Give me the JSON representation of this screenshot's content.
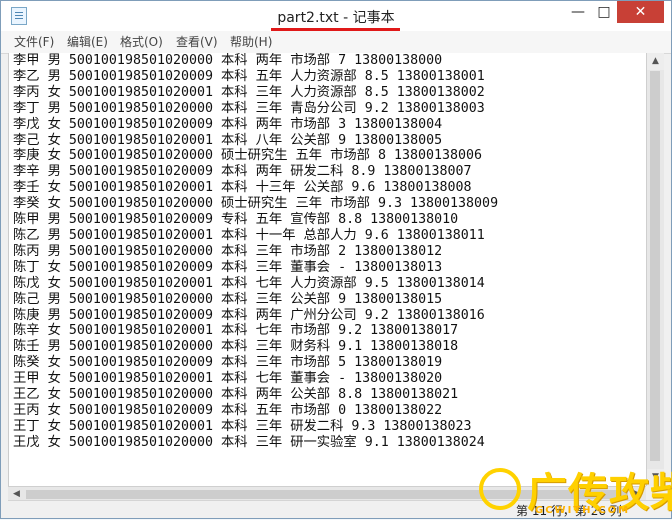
{
  "window": {
    "title": "part2.txt - 记事本",
    "controls": {
      "minimize": "—",
      "maximize": "□",
      "close": "✕"
    }
  },
  "menu": [
    "文件(F)",
    "编辑(E)",
    "格式(O)",
    "查看(V)",
    "帮助(H)"
  ],
  "lines": [
    "李甲 男 500100198501020000 本科 两年 市场部 7 13800138000",
    "李乙 男 500100198501020009 本科 五年 人力资源部 8.5 13800138001",
    "李丙 女 500100198501020001 本科 三年 人力资源部 8.5 13800138002",
    "李丁 男 500100198501020000 本科 三年 青岛分公司 9.2 13800138003",
    "李戊 女 500100198501020009 本科 两年 市场部 3 13800138004",
    "李己 女 500100198501020001 本科 八年 公关部 9 13800138005",
    "李庚 女 500100198501020000 硕士研究生 五年 市场部 8 13800138006",
    "李辛 男 500100198501020009 本科 两年 研发二科 8.9 13800138007",
    "李壬 女 500100198501020001 本科 十三年 公关部 9.6 13800138008",
    "李癸 女 500100198501020000 硕士研究生 三年 市场部 9.3 13800138009",
    "陈甲 男 500100198501020009 专科 五年 宣传部 8.8 13800138010",
    "陈乙 男 500100198501020001 本科 十一年 总部人力 9.6 13800138011",
    "陈丙 男 500100198501020000 本科 三年 市场部 2 13800138012",
    "陈丁 女 500100198501020009 本科 三年 董事会 - 13800138013",
    "陈戊 女 500100198501020001 本科 七年 人力资源部 9.5 13800138014",
    "陈己 男 500100198501020000 本科 三年 公关部 9 13800138015",
    "陈庚 男 500100198501020009 本科 两年 广州分公司 9.2 13800138016",
    "陈辛 女 500100198501020001 本科 七年 市场部 9.2 13800138017",
    "陈壬 男 500100198501020000 本科 三年 财务科 9.1 13800138018",
    "陈癸 女 500100198501020009 本科 三年 市场部 5 13800138019",
    "王甲 女 500100198501020001 本科 七年 董事会 - 13800138020",
    "王乙 女 500100198501020000 本科 两年 公关部 8.8 13800138021",
    "王丙 女 500100198501020009 本科 五年 市场部 0 13800138022",
    "王丁 女 500100198501020001 本科 三年 研发二科 9.3 13800138023",
    "王戊 女 500100198501020000 本科 三年 研一实验室 9.1 13800138024"
  ],
  "status": "第 11 行，第 26 列",
  "watermark": {
    "title": "广传攻柴",
    "subtitle": "GCWITH.COM"
  }
}
